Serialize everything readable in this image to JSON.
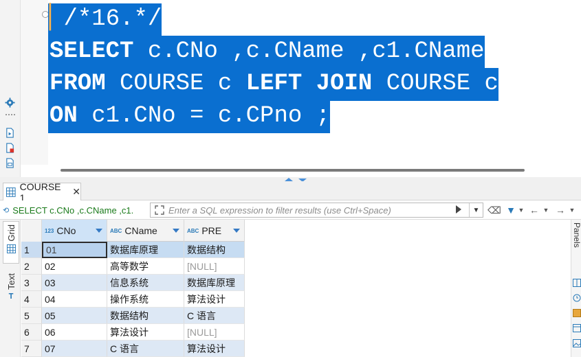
{
  "editor": {
    "lines": [
      {
        "comment": "/*16.*/"
      },
      {
        "kw": "SELECT",
        "rest": " c.CNo ,c.CName ,c1.CName"
      },
      {
        "kw1": "FROM",
        "mid1": " COURSE c ",
        "kw2": "LEFT JOIN",
        "rest": " COURSE c"
      },
      {
        "kw": "ON",
        "rest": " c1.CNo = c.CPno ;"
      }
    ],
    "selection_color": "#0a6fd0"
  },
  "result_tab": {
    "label": "COURSE 1",
    "close": "✕"
  },
  "filter_bar": {
    "query_text": "SELECT c.CNo ,c.CName ,c1.",
    "placeholder": "Enter a SQL expression to filter results (use Ctrl+Space)"
  },
  "side_tabs": {
    "grid": "Grid",
    "text": "Text"
  },
  "right_panel": {
    "label": "Panels"
  },
  "grid": {
    "columns": [
      {
        "name": "CNo",
        "type": "123"
      },
      {
        "name": "CName",
        "type": "ABC"
      },
      {
        "name": "PRE",
        "type": "ABC"
      }
    ],
    "rows": [
      {
        "n": "1",
        "cells": [
          "01",
          "数据库原理",
          "数据结构"
        ]
      },
      {
        "n": "2",
        "cells": [
          "02",
          "高等数学",
          "[NULL]"
        ]
      },
      {
        "n": "3",
        "cells": [
          "03",
          "信息系统",
          "数据库原理"
        ]
      },
      {
        "n": "4",
        "cells": [
          "04",
          "操作系统",
          "算法设计"
        ]
      },
      {
        "n": "5",
        "cells": [
          "05",
          "数据结构",
          "C 语言"
        ]
      },
      {
        "n": "6",
        "cells": [
          "06",
          "算法设计",
          "[NULL]"
        ]
      },
      {
        "n": "7",
        "cells": [
          "07",
          "C 语言",
          "算法设计"
        ]
      }
    ]
  },
  "colors": {
    "accent": "#3479c4",
    "row_alt": "#dde8f5",
    "null_text": "#9a9a9a"
  }
}
